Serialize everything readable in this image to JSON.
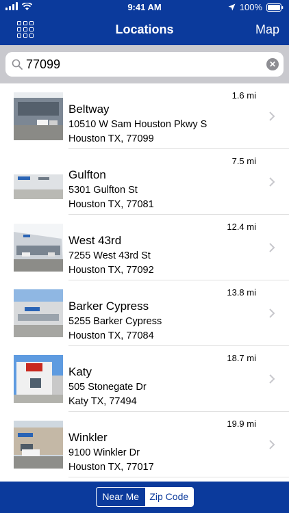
{
  "status": {
    "time": "9:41 AM",
    "battery": "100%"
  },
  "nav": {
    "title": "Locations",
    "map_label": "Map"
  },
  "search": {
    "value": "77099",
    "placeholder": ""
  },
  "locations": [
    {
      "name": "Beltway",
      "address": "10510 W Sam Houston Pkwy S",
      "city": "Houston TX, 77099",
      "distance": "1.6 mi"
    },
    {
      "name": "Gulfton",
      "address": "5301 Gulfton St",
      "city": "Houston TX, 77081",
      "distance": "7.5 mi"
    },
    {
      "name": "West 43rd",
      "address": "7255 West 43rd St",
      "city": "Houston TX, 77092",
      "distance": "12.4 mi"
    },
    {
      "name": "Barker Cypress",
      "address": "5255 Barker Cypress",
      "city": "Houston TX, 77084",
      "distance": "13.8 mi"
    },
    {
      "name": "Katy",
      "address": "505 Stonegate Dr",
      "city": "Katy TX, 77494",
      "distance": "18.7 mi"
    },
    {
      "name": "Winkler",
      "address": "9100 Winkler Dr",
      "city": "Houston TX, 77017",
      "distance": "19.9 mi"
    }
  ],
  "segment": {
    "near_me": "Near Me",
    "zip_code": "Zip Code",
    "selected": "Zip Code"
  },
  "colors": {
    "brand": "#0b3a9c",
    "search_bg": "#c9c9ce"
  },
  "icons": {
    "menu": "grid-icon",
    "search": "search-icon",
    "clear": "clear-icon",
    "chevron": "chevron-right-icon"
  }
}
